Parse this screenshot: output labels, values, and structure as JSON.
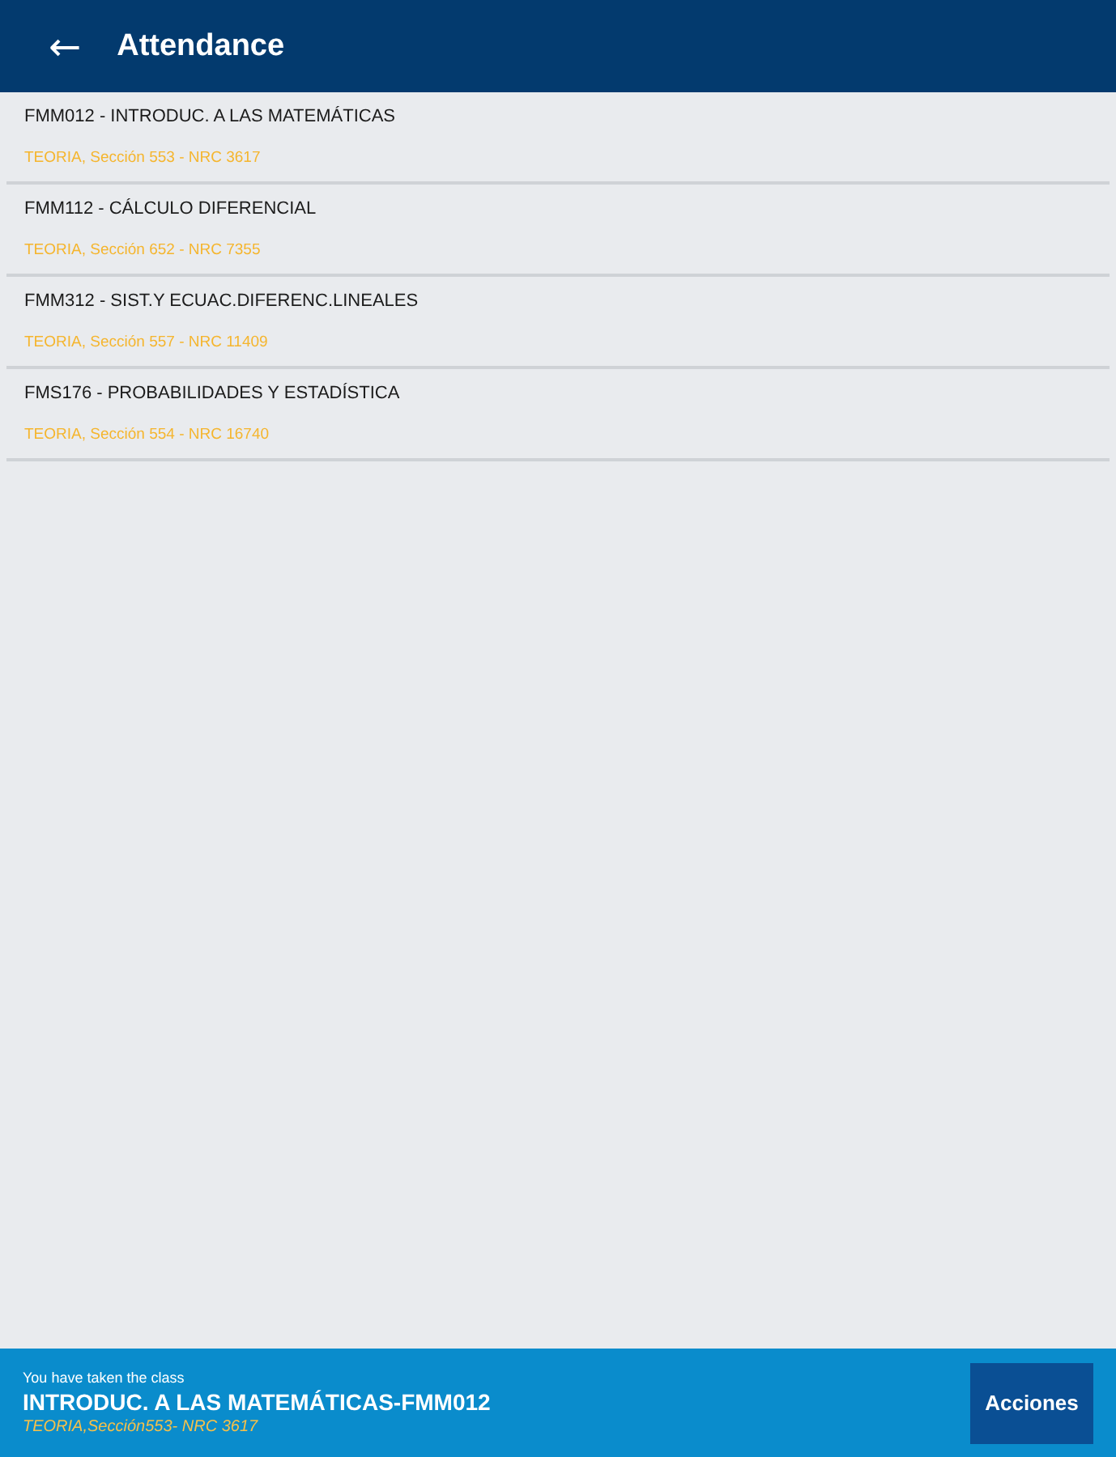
{
  "app_bar": {
    "back_icon": "←",
    "title": "Attendance"
  },
  "courses": [
    {
      "title": "FMM012 - INTRODUC. A LAS MATEMÁTICAS",
      "detail": "TEORIA, Sección 553 - NRC 3617"
    },
    {
      "title": "FMM112 - CÁLCULO DIFERENCIAL",
      "detail": "TEORIA, Sección 652 - NRC 7355"
    },
    {
      "title": "FMM312 - SIST.Y ECUAC.DIFERENC.LINEALES",
      "detail": "TEORIA, Sección 557 - NRC 11409"
    },
    {
      "title": "FMS176 - PROBABILIDADES Y ESTADÍSTICA",
      "detail": "TEORIA, Sección 554 - NRC 16740"
    }
  ],
  "bottom_bar": {
    "caption": "You have taken the class",
    "course": "INTRODUC. A LAS MATEMÁTICAS-FMM012",
    "detail": "TEORIA,Sección553- NRC 3617",
    "action": "Acciones"
  }
}
